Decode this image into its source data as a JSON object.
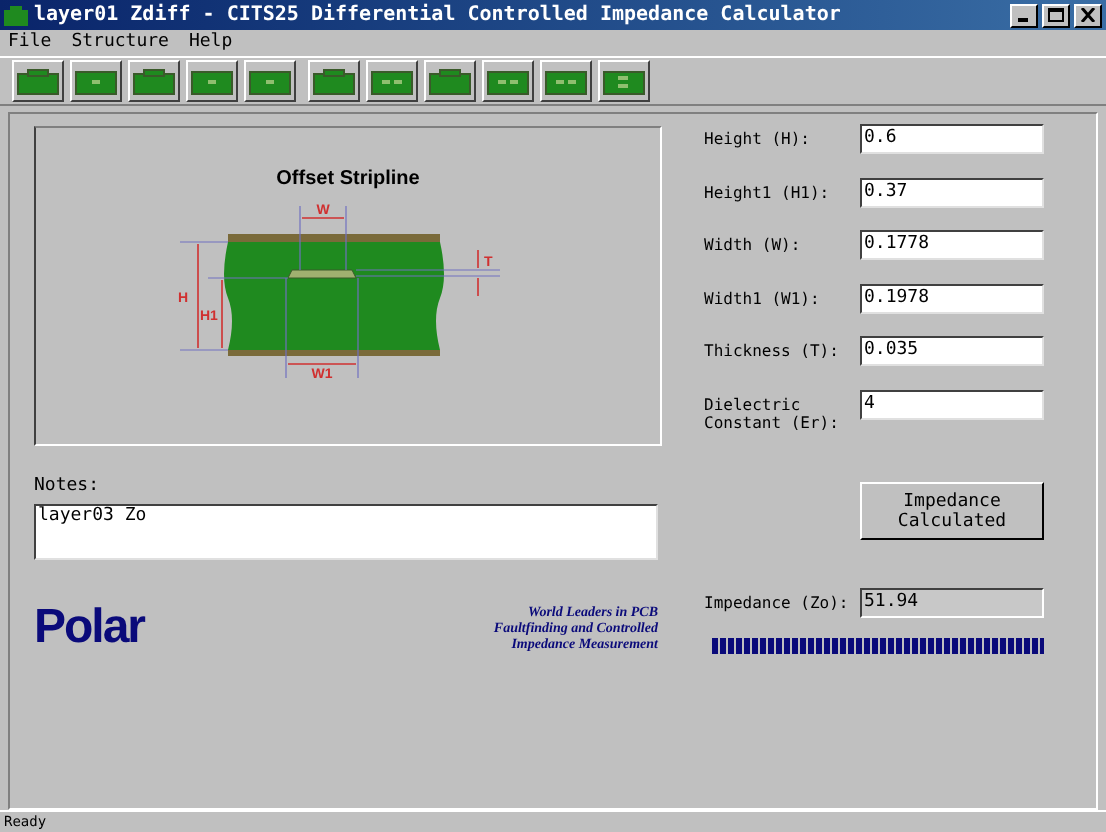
{
  "window": {
    "title": "layer01 Zdiff - CITS25 Differential Controlled Impedance Calculator"
  },
  "menu": [
    "File",
    "Structure",
    "Help"
  ],
  "toolbar_groups": [
    [
      {
        "kind": "raised"
      },
      {
        "kind": "single"
      },
      {
        "kind": "raised"
      },
      {
        "kind": "single"
      },
      {
        "kind": "single"
      }
    ],
    [
      {
        "kind": "raised"
      },
      {
        "kind": "double"
      },
      {
        "kind": "raised"
      },
      {
        "kind": "double"
      },
      {
        "kind": "double"
      },
      {
        "kind": "stacked"
      }
    ]
  ],
  "diagram": {
    "title": "Offset Stripline",
    "labels": {
      "w": "W",
      "t": "T",
      "h": "H",
      "h1": "H1",
      "w1": "W1"
    }
  },
  "fields": [
    {
      "label": "Height (H):",
      "value": "0.6"
    },
    {
      "label": "Height1 (H1):",
      "value": "0.37"
    },
    {
      "label": "Width (W):",
      "value": "0.1778"
    },
    {
      "label": "Width1 (W1):",
      "value": "0.1978"
    },
    {
      "label": "Thickness (T):",
      "value": "0.035"
    },
    {
      "label": "Dielectric Constant (Er):",
      "value": "4"
    }
  ],
  "notes": {
    "label": "Notes:",
    "value": "layer03 Zo"
  },
  "calculate_button": "Impedance Calculated",
  "logo": "Polar",
  "tagline": [
    "World Leaders in PCB",
    "Faultfinding and Controlled",
    "Impedance Measurement"
  ],
  "result": {
    "label": "Impedance (Zo):",
    "value": "51.94"
  },
  "progress": {
    "level": 1
  },
  "status_bar": "Ready"
}
